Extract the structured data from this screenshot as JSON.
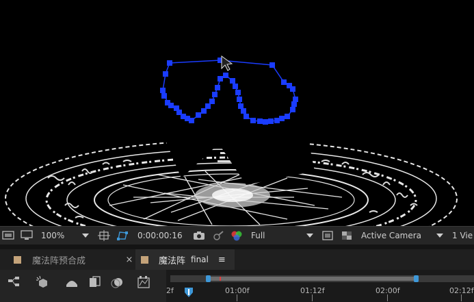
{
  "viewer_toolbar": {
    "zoom": "100%",
    "timecode": "0:00:00:16",
    "resolution": "Full",
    "camera": "Active Camera",
    "views": "1 Vie"
  },
  "tabs": [
    {
      "label": "魔法阵预合成"
    },
    {
      "label": "魔法阵",
      "suffix": "final"
    }
  ],
  "tab_close": "×",
  "tab_menu": "≡",
  "ruler": {
    "start_label": "2f",
    "labels": [
      "01:00f",
      "01:12f",
      "02:00f",
      "02:12f"
    ]
  },
  "colors": {
    "mask_path": "#1a3cff",
    "playhead": "#3e98d8",
    "tab_swatch": "#c4a37a"
  }
}
